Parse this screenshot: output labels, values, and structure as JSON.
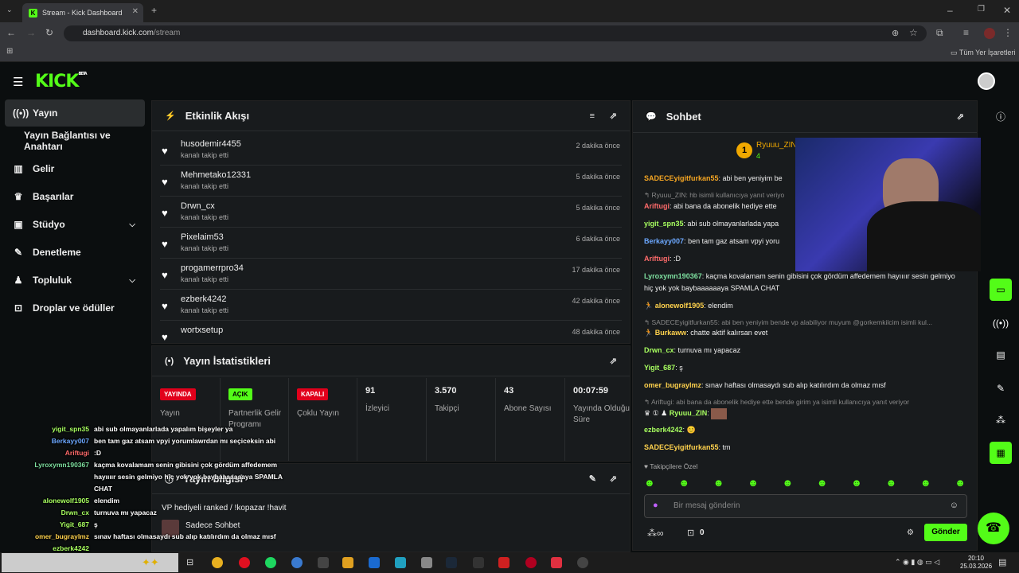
{
  "browser": {
    "tab_title": "Stream - Kick Dashboard",
    "url_host": "dashboard.kick.com",
    "url_path": "/stream",
    "bookmarks_label": "Tüm Yer İşaretleri"
  },
  "brand": {
    "logo": "KICK",
    "beta": "BETA",
    "accent": "#53fc18"
  },
  "sidebar": {
    "items": [
      {
        "label": "Yayın",
        "icon": "broadcast-icon"
      },
      {
        "label": "Yayın Bağlantısı ve Anahtarı"
      },
      {
        "label": "Gelir",
        "icon": "chart-icon"
      },
      {
        "label": "Başarılar",
        "icon": "trophy-icon"
      },
      {
        "label": "Stüdyo",
        "icon": "studio-icon"
      },
      {
        "label": "Denetleme",
        "icon": "wrench-icon"
      },
      {
        "label": "Topluluk",
        "icon": "people-icon"
      },
      {
        "label": "Droplar ve ödüller",
        "icon": "gift-icon"
      }
    ]
  },
  "activity": {
    "title": "Etkinlik Akışı",
    "items": [
      {
        "user": "husodemir4455",
        "action": "kanalı takip etti",
        "time": "2 dakika önce"
      },
      {
        "user": "Mehmetako12331",
        "action": "kanalı takip etti",
        "time": "5 dakika önce"
      },
      {
        "user": "Drwn_cx",
        "action": "kanalı takip etti",
        "time": "5 dakika önce"
      },
      {
        "user": "Pixelaim53",
        "action": "kanalı takip etti",
        "time": "6 dakika önce"
      },
      {
        "user": "progamerrpro34",
        "action": "kanalı takip etti",
        "time": "17 dakika önce"
      },
      {
        "user": "ezberk4242",
        "action": "kanalı takip etti",
        "time": "42 dakika önce"
      },
      {
        "user": "wortxsetup",
        "action": "",
        "time": "48 dakika önce"
      }
    ]
  },
  "stats": {
    "title": "Yayın İstatistikleri",
    "cells": [
      {
        "badge": "YAYINDA",
        "label": "Yayın"
      },
      {
        "badge": "AÇIK",
        "label": "Partnerlik Gelir Programı"
      },
      {
        "badge": "KAPALI",
        "label": "Çoklu Yayın"
      },
      {
        "value": "91",
        "label": "İzleyici"
      },
      {
        "value": "3.570",
        "label": "Takipçi"
      },
      {
        "value": "43",
        "label": "Abone Sayısı"
      },
      {
        "value": "00:07:59",
        "label": "Yayında Olduğu Süre"
      }
    ]
  },
  "streaminfo": {
    "title": "Yayın bilgisi",
    "stream_title": "VP hediyeli ranked / !kopazar !havit",
    "chat_mode": "Sadece Sohbet"
  },
  "chat": {
    "title": "Sohbet",
    "pinned_user": "Ryuuu_ZIN",
    "pinned_count": "4",
    "messages": [
      {
        "user": "SADECEyigitfurkan55",
        "text": "abi ben yeniyim be",
        "color": "#f5a623"
      },
      {
        "reply": "Ryuuu_ZIN: hb isimli kullanıcıya yanıt veriyo"
      },
      {
        "user": "Ariftugi",
        "text": "abi bana da abonelik hediye ette",
        "color": "#ff6b6b"
      },
      {
        "user": "yigit_spn35",
        "text": "abi sub olmayanlarlada yapa",
        "color": "#a8ff60"
      },
      {
        "user": "Berkayy007",
        "text": "ben tam gaz atsam vpyi yoru",
        "color": "#6ca8ff"
      },
      {
        "user": "Ariftugi",
        "text": ":D",
        "color": "#ff6b6b"
      },
      {
        "user": "Lyroxymn190367",
        "text": "kaçma kovalamam senin gibisini çok gördüm affedemem hayıııır sesin gelmiyo hiç yok yok baybaaaaaaya SPAMLA CHAT",
        "color": "#7ee0a0"
      },
      {
        "user": "alonewolf1905",
        "text": "elendim",
        "color": "#ffd24d"
      },
      {
        "reply": "SADECEyigitfurkan55: abi ben yeniyim bende vp alabiliyor muyum @gorkemkilcim isimli kul..."
      },
      {
        "user": "Burkaww",
        "text": "chatte aktif kalırsan evet",
        "color": "#ffd24d"
      },
      {
        "user": "Drwn_cx",
        "text": "turnuva mı yapacaz",
        "color": "#a8ff60"
      },
      {
        "user": "Yigit_687",
        "text": "ş",
        "color": "#a8ff60"
      },
      {
        "user": "omer_bugraylmz",
        "text": "sınav haftası olmasaydı sub alıp katılırdım da olmaz mısf",
        "color": "#ffd24d"
      },
      {
        "reply": "Ariftugi: abi bana da abonelik hediye ette bende girim ya isimli kullanıcıya yanıt veriyor"
      },
      {
        "user": "Ryuuu_ZIN",
        "text": "",
        "color": "#a8ff60"
      },
      {
        "user": "ezberk4242",
        "text": "",
        "color": "#a8ff60"
      },
      {
        "user": "SADECEyigitfurkan55",
        "text": "tm",
        "color": "#ffd24d"
      }
    ],
    "followers_only": "Takipçilere Özel",
    "input_placeholder": "Bir mesaj gönderin",
    "points": "0",
    "send_label": "Gönder"
  },
  "overlay_chat": [
    {
      "user": "yigit_spn35",
      "text": "abi sub olmayanlarlada yapalım bişeyler ya",
      "color": "#a8ff60"
    },
    {
      "user": "Berkayy007",
      "text": "ben tam gaz atsam vpyi yorumlawrdan mı seçiceksin abi",
      "color": "#6ca8ff"
    },
    {
      "user": "Ariftugi",
      "text": ":D",
      "color": "#ff6b6b"
    },
    {
      "user": "Lyroxymn190367",
      "text": "kaçma kovalamam senin gibisini çok gördüm affedemem",
      "color": "#7ee0a0"
    },
    {
      "user": "",
      "text": "hayıııır sesin gelmiyo hiç yok yok baybaaaaaaaya SPAMLA",
      "color": "#fff"
    },
    {
      "user": "",
      "text": "CHAT",
      "color": "#fff"
    },
    {
      "user": "alonewolf1905",
      "text": "elendim",
      "color": "#a8ff60"
    },
    {
      "user": "Drwn_cx",
      "text": "turnuva mı yapacaz",
      "color": "#a8ff60"
    },
    {
      "user": "Yigit_687",
      "text": "ş",
      "color": "#a8ff60"
    },
    {
      "user": "omer_bugraylmz",
      "text": "sınav haftası olmasaydı sub alıp katılırdım da olmaz mısf",
      "color": "#ffd24d"
    },
    {
      "user": "ezberk4242",
      "text": "",
      "color": "#a8ff60"
    }
  ],
  "taskbar": {
    "time": "20:10",
    "date": "25.03.2026"
  }
}
